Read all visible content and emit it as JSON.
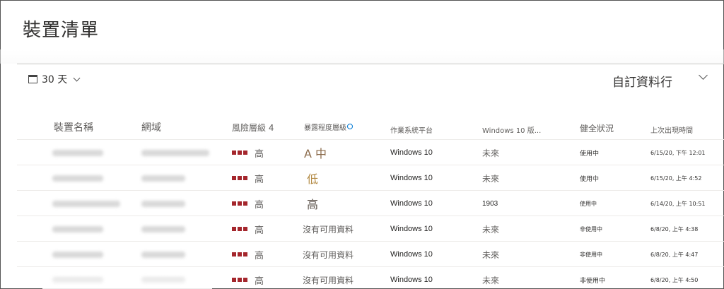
{
  "page": {
    "title": "裝置清單"
  },
  "toolbar": {
    "date_range_label": "30 天",
    "custom_columns_label": "自訂資料行"
  },
  "table": {
    "headers": {
      "device_name": "裝置名稱",
      "domain": "網域",
      "risk_level": "風險層級 4",
      "exposure_level": "暴露程度層級",
      "os_platform": "作業系統平台",
      "windows_version": "Windows 10 版...",
      "health_state": "健全狀況",
      "last_seen": "上次出現時間"
    },
    "rows": [
      {
        "risk": "高",
        "exposure": "A 中",
        "exposure_style": "med",
        "os": "Windows 10",
        "version": "未來",
        "health": "使用中",
        "last_seen": "6/15/20, 下午 12:01"
      },
      {
        "risk": "高",
        "exposure": "低",
        "exposure_style": "low",
        "os": "Windows 10",
        "version": "未來",
        "health": "使用中",
        "last_seen": "6/15/20, 上午 4:52"
      },
      {
        "risk": "高",
        "exposure": "高",
        "exposure_style": "high",
        "os": "Windows 10",
        "version": "1903",
        "health": "使用中",
        "last_seen": "6/14/20, 上午 10:51"
      },
      {
        "risk": "高",
        "exposure": "沒有可用資料",
        "exposure_style": "none",
        "os": "Windows 10",
        "version": "未來",
        "health": "非使用中",
        "last_seen": "6/8/20, 上午 4:38"
      },
      {
        "risk": "高",
        "exposure": "沒有可用資料",
        "exposure_style": "none",
        "os": "Windows 10",
        "version": "未來",
        "health": "非使用中",
        "last_seen": "6/8/20, 上午 4:47"
      },
      {
        "risk": "高",
        "exposure": "沒有可用資料",
        "exposure_style": "none",
        "os": "Windows 10",
        "version": "未來",
        "health": "非使用中",
        "last_seen": "6/8/20, 上午 4:50"
      }
    ]
  },
  "colors": {
    "risk_high": "#a4262c",
    "info_accent": "#0078d4"
  }
}
